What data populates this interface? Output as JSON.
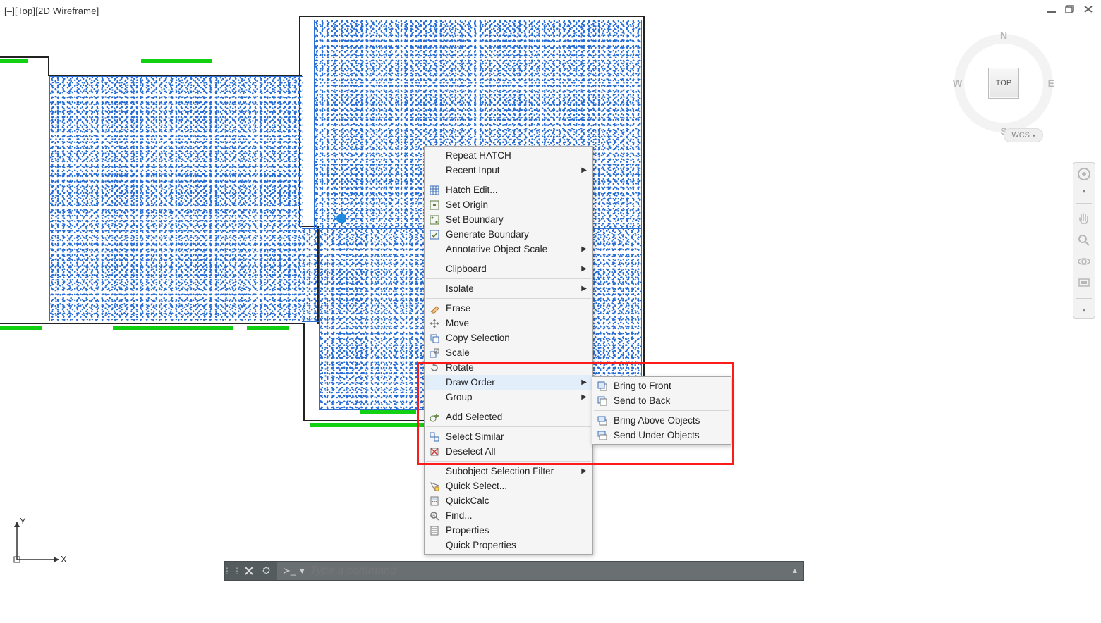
{
  "viewportLabel": "[–][Top][2D Wireframe]",
  "viewcube": {
    "face": "TOP",
    "n": "N",
    "s": "S",
    "e": "E",
    "w": "W",
    "wcs": "WCS"
  },
  "commandBar": {
    "placeholder": "Type a command"
  },
  "ucs": {
    "x": "X",
    "y": "Y"
  },
  "contextMenu": {
    "items": [
      {
        "label": "Repeat HATCH",
        "icon": "",
        "submenu": false
      },
      {
        "label": "Recent Input",
        "icon": "",
        "submenu": true
      },
      {
        "sep": true
      },
      {
        "label": "Hatch Edit...",
        "icon": "hatch-edit",
        "submenu": false
      },
      {
        "label": "Set Origin",
        "icon": "set-origin",
        "submenu": false
      },
      {
        "label": "Set Boundary",
        "icon": "set-boundary",
        "submenu": false
      },
      {
        "label": "Generate Boundary",
        "icon": "gen-boundary",
        "submenu": false
      },
      {
        "label": "Annotative Object Scale",
        "icon": "",
        "submenu": true
      },
      {
        "sep": true
      },
      {
        "label": "Clipboard",
        "icon": "",
        "submenu": true
      },
      {
        "sep": true
      },
      {
        "label": "Isolate",
        "icon": "",
        "submenu": true
      },
      {
        "sep": true
      },
      {
        "label": "Erase",
        "icon": "erase",
        "submenu": false
      },
      {
        "label": "Move",
        "icon": "move",
        "submenu": false
      },
      {
        "label": "Copy Selection",
        "icon": "copy",
        "submenu": false
      },
      {
        "label": "Scale",
        "icon": "scale",
        "submenu": false
      },
      {
        "label": "Rotate",
        "icon": "rotate",
        "submenu": false
      },
      {
        "label": "Draw Order",
        "icon": "",
        "submenu": true,
        "hover": true
      },
      {
        "label": "Group",
        "icon": "",
        "submenu": true
      },
      {
        "sep": true
      },
      {
        "label": "Add Selected",
        "icon": "add-selected",
        "submenu": false
      },
      {
        "sep": true
      },
      {
        "label": "Select Similar",
        "icon": "select-similar",
        "submenu": false
      },
      {
        "label": "Deselect All",
        "icon": "deselect",
        "submenu": false
      },
      {
        "sep": true
      },
      {
        "label": "Subobject Selection Filter",
        "icon": "",
        "submenu": true
      },
      {
        "label": "Quick Select...",
        "icon": "quick-select",
        "submenu": false
      },
      {
        "label": "QuickCalc",
        "icon": "quickcalc",
        "submenu": false
      },
      {
        "label": "Find...",
        "icon": "find",
        "submenu": false
      },
      {
        "label": "Properties",
        "icon": "properties",
        "submenu": false
      },
      {
        "label": "Quick Properties",
        "icon": "",
        "submenu": false
      }
    ]
  },
  "submenu": {
    "items": [
      {
        "label": "Bring to Front",
        "icon": "front"
      },
      {
        "label": "Send to Back",
        "icon": "back"
      },
      {
        "sep": true
      },
      {
        "label": "Bring Above Objects",
        "icon": "above"
      },
      {
        "label": "Send Under Objects",
        "icon": "under"
      }
    ]
  }
}
